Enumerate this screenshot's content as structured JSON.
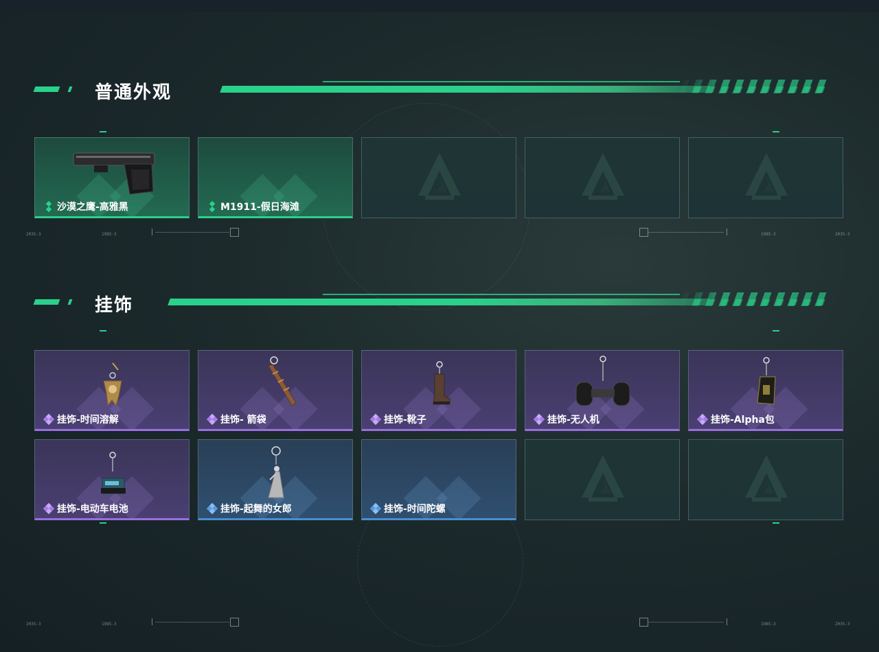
{
  "sections": [
    {
      "title": "普通外观"
    },
    {
      "title": "挂饰"
    }
  ],
  "skins": [
    {
      "label": "沙漠之鹰-高雅黑",
      "rarity": "green",
      "icon": "desert-eagle-pistol"
    },
    {
      "label": "M1911-假日海滩",
      "rarity": "green",
      "icon": "none"
    },
    {
      "label": "",
      "rarity": "empty",
      "icon": "logo"
    },
    {
      "label": "",
      "rarity": "empty",
      "icon": "logo"
    },
    {
      "label": "",
      "rarity": "empty",
      "icon": "logo"
    }
  ],
  "charms": [
    {
      "label": "挂饰-时间溶解",
      "rarity": "purple",
      "icon": "melting-clock-charm"
    },
    {
      "label": "挂饰- 箭袋",
      "rarity": "purple",
      "icon": "quiver-charm"
    },
    {
      "label": "挂饰-靴子",
      "rarity": "purple",
      "icon": "boot-charm"
    },
    {
      "label": "挂饰-无人机",
      "rarity": "purple",
      "icon": "drone-charm"
    },
    {
      "label": "挂饰-Alpha包",
      "rarity": "purple",
      "icon": "bag-charm"
    },
    {
      "label": "挂饰-电动车电池",
      "rarity": "purple",
      "icon": "battery-charm"
    },
    {
      "label": "挂饰-起舞的女郎",
      "rarity": "blue",
      "icon": "dancer-charm"
    },
    {
      "label": "挂饰-时间陀螺",
      "rarity": "blue",
      "icon": "none"
    },
    {
      "label": "",
      "rarity": "empty",
      "icon": "logo"
    },
    {
      "label": "",
      "rarity": "empty",
      "icon": "logo"
    }
  ],
  "colors": {
    "accent": "#2ad18a",
    "purple": "#9a6fe0",
    "blue": "#4a8fd0"
  }
}
